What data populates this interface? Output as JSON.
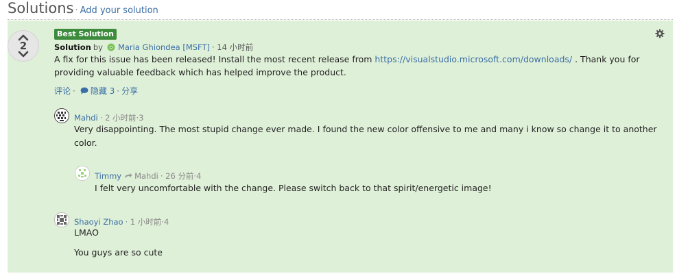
{
  "header": {
    "title": "Solutions",
    "separator": "·",
    "add_solution": "Add your solution"
  },
  "solution": {
    "votes": "2",
    "badge": "Best Solution",
    "type_label": "Solution",
    "by": "by",
    "author": "Maria Ghiondea [MSFT]",
    "time": "· 14 小时前",
    "body_part1": "A fix for this issue has been released! Install the most recent release from ",
    "link": "https://visualstudio.microsoft.com/downloads/",
    "body_part2": " . Thank you for providing valuable feedback which has helped improve the product.",
    "actions": {
      "comment": "评论",
      "dot1": "·",
      "hidden": "隐藏 3",
      "dot2": "·",
      "share": "分享"
    }
  },
  "comments": [
    {
      "author": "Mahdi",
      "time": "· 2 小时前",
      "votes": "·3",
      "text": "Very disappointing. The most stupid change ever made. I found the new color offensive to me and many i know so change it to another color."
    },
    {
      "author": "Timmy",
      "reply_to": "Mahdi",
      "time": "· 26 分前",
      "votes": "·4",
      "text": "I felt very uncomfortable with the change. Please switch back to that spirit/energetic image!"
    },
    {
      "author": "Shaoyi Zhao",
      "time": "· 1 小时前",
      "votes": "·4",
      "text_line1": "LMAO",
      "text_line2": "You guys are so cute"
    }
  ],
  "colors": {
    "panel": "#dff0d8",
    "badge": "#3d8b3d",
    "link": "#3a6ea5"
  },
  "icons": [
    "chevron-up-icon",
    "chevron-down-icon",
    "gear-icon",
    "comment-bubble-icon",
    "reply-arrow-icon",
    "avatar-icon"
  ]
}
